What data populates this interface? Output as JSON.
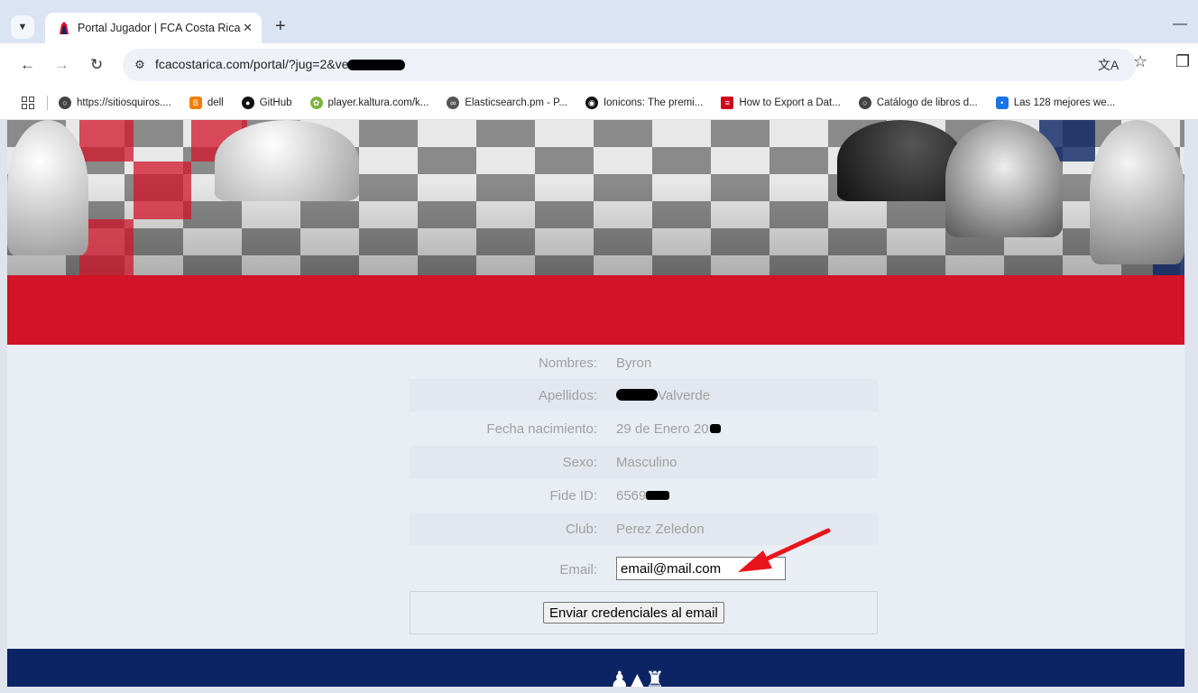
{
  "browser": {
    "tab_title": "Portal Jugador | FCA Costa Rica",
    "tab_close": "✕",
    "new_tab": "+",
    "url": "fcacostarica.com/portal/?jug=2&ver",
    "icons": [
      "tab-search-icon",
      "back-icon",
      "forward-icon",
      "reload-icon",
      "site-info-icon",
      "translate-icon",
      "star-icon",
      "extensions-icon",
      "apps-icon"
    ]
  },
  "bookmarks": [
    {
      "label": "https://sitiosquiros....",
      "icon": "globe",
      "color": "#444444"
    },
    {
      "label": "dell",
      "icon": "blogger",
      "color": "#f57d00"
    },
    {
      "label": "GitHub",
      "icon": "github",
      "color": "#111111"
    },
    {
      "label": "player.kaltura.com/k...",
      "icon": "kaltura",
      "color": "#7fb241"
    },
    {
      "label": "Elasticsearch.pm - P...",
      "icon": "elastic",
      "color": "#555555"
    },
    {
      "label": "Ionicons: The premi...",
      "icon": "ionicons",
      "color": "#111111"
    },
    {
      "label": "How to Export a Dat...",
      "icon": "flag",
      "color": "#d0021b"
    },
    {
      "label": "Catálogo de libros d...",
      "icon": "globe",
      "color": "#444444"
    },
    {
      "label": "Las 128 mejores we...",
      "icon": "dots",
      "color": "#1a73e8"
    }
  ],
  "player": {
    "nombres": {
      "label": "Nombres:",
      "value": "Byron"
    },
    "apellidos": {
      "label": "Apellidos:",
      "value": "Valverde"
    },
    "fecha": {
      "label": "Fecha nacimiento:",
      "value": "29 de Enero 20"
    },
    "sexo": {
      "label": "Sexo:",
      "value": "Masculino"
    },
    "fide": {
      "label": "Fide ID:",
      "value": "6569"
    },
    "club": {
      "label": "Club:",
      "value": "Perez Zeledon"
    },
    "email": {
      "label": "Email:",
      "value": "email@mail.com"
    }
  },
  "actions": {
    "send_label": "Enviar credenciales al email"
  },
  "colors": {
    "red_band": "#d11428",
    "footer": "#0d2464",
    "annotation_arrow": "#e8141c"
  }
}
